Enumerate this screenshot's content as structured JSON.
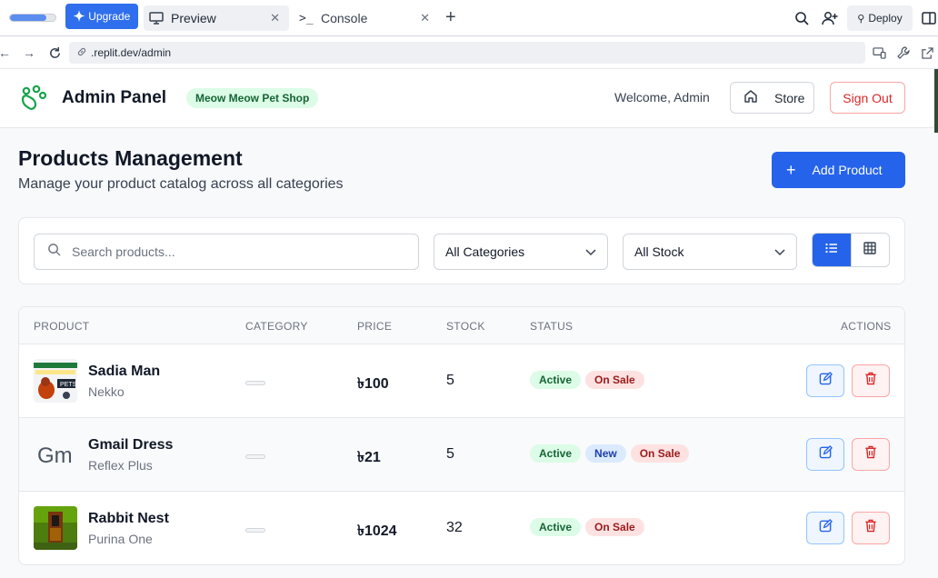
{
  "browser": {
    "load_progress": 0.8,
    "upgrade_label": "Upgrade",
    "tabs": [
      {
        "label": "Preview",
        "icon": "monitor-icon"
      },
      {
        "label": "Console",
        "icon": "terminal-icon"
      }
    ],
    "deploy_label": "Deploy",
    "url_domain": ".replit.dev",
    "url_path": "/admin"
  },
  "header": {
    "title": "Admin Panel",
    "shop_badge": "Meow Meow Pet Shop",
    "welcome": "Welcome, Admin",
    "store_label": "Store",
    "signout_label": "Sign Out"
  },
  "page": {
    "title": "Products Management",
    "subtitle": "Manage your product catalog across all categories",
    "add_label": "Add Product"
  },
  "filters": {
    "search_placeholder": "Search products...",
    "category_value": "All Categories",
    "stock_value": "All Stock",
    "view_mode": "list"
  },
  "table": {
    "columns": [
      "PRODUCT",
      "CATEGORY",
      "PRICE",
      "STOCK",
      "STATUS",
      "ACTIONS"
    ],
    "rows": [
      {
        "name": "Sadia Man",
        "brand": "Nekko",
        "price": "৳100",
        "stock": "5",
        "badges": [
          "Active",
          "On Sale"
        ]
      },
      {
        "name": "Gmail Dress",
        "brand": "Reflex Plus",
        "price": "৳21",
        "stock": "5",
        "badges": [
          "Active",
          "New",
          "On Sale"
        ]
      },
      {
        "name": "Rabbit Nest",
        "brand": "Purina One",
        "price": "৳1024",
        "stock": "32",
        "badges": [
          "Active",
          "On Sale"
        ]
      }
    ]
  },
  "colors": {
    "primary": "#2563eb",
    "brand_green": "#15803d",
    "danger": "#dc2626"
  }
}
